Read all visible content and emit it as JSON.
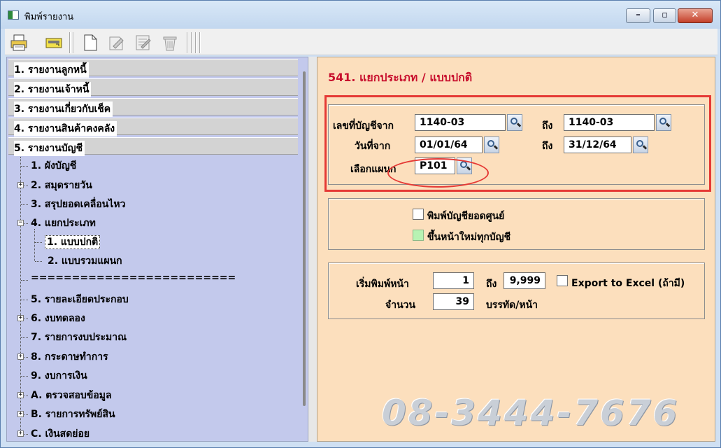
{
  "window": {
    "title": "พิมพ์รายงาน"
  },
  "toolbar": {
    "buttons": [
      "printer-icon",
      "keyboard-icon",
      "new-document-icon",
      "edit-icon",
      "notepad-icon",
      "trash-icon"
    ]
  },
  "sidebar": {
    "categories": [
      {
        "label": "1. รายงานลูกหนี้"
      },
      {
        "label": "2. รายงานเจ้าหนี้"
      },
      {
        "label": "3. รายงานเกี่ยวกับเช็ค"
      },
      {
        "label": "4. รายงานสินค้าคงคลัง"
      },
      {
        "label": "5. รายงานบัญชี"
      }
    ],
    "items": [
      {
        "label": "1. ผังบัญชี"
      },
      {
        "label": "2. สมุดรายวัน"
      },
      {
        "label": "3. สรุปยอดเคลื่อนไหว"
      },
      {
        "label": "4. แยกประเภท"
      },
      {
        "label": "1. แบบปกติ"
      },
      {
        "label": "2. แบบรวมแผนก"
      },
      {
        "label": "========================="
      },
      {
        "label": "5. รายละเอียดประกอบ"
      },
      {
        "label": "6. งบทดลอง"
      },
      {
        "label": "7. รายการงบประมาณ"
      },
      {
        "label": "8. กระดาษทำการ"
      },
      {
        "label": "9. งบการเงิน"
      },
      {
        "label": "A. ตรวจสอบข้อมูล"
      },
      {
        "label": "B. รายการทรัพย์สิน"
      },
      {
        "label": "C. เงินสดย่อย"
      }
    ]
  },
  "main": {
    "report_title": "541. แยกประเภท / แบบปกติ",
    "account_from_label": "เลขที่บัญชีจาก",
    "account_from_value": "1140-03",
    "account_to_label": "ถึง",
    "account_to_value": "1140-03",
    "date_from_label": "วันที่จาก",
    "date_from_value": "01/01/64",
    "date_to_label": "ถึง",
    "date_to_value": "31/12/64",
    "department_label": "เลือกแผนก",
    "department_value": "P101",
    "print_zero_label": "พิมพ์บัญชียอดศูนย์",
    "print_zero_checked": false,
    "new_page_label": "ขึ้นหน้าใหม่ทุกบัญชี",
    "new_page_checked": false,
    "start_page_label": "เริ่มพิมพ์หน้า",
    "start_page_value": "1",
    "page_to_label": "ถึง",
    "page_to_value": "9,999",
    "export_label": "Export to Excel (ถ้ามี)",
    "export_checked": false,
    "lines_label": "จำนวน",
    "lines_value": "39",
    "lines_unit": "บรรทัด/หน้า"
  },
  "watermark": "08-3444-7676",
  "colors": {
    "report_title": "#c8102e",
    "right_pane_bg": "#fcdfbd",
    "left_pane_bg": "#c3c9ec",
    "highlight_red": "#e53935"
  }
}
